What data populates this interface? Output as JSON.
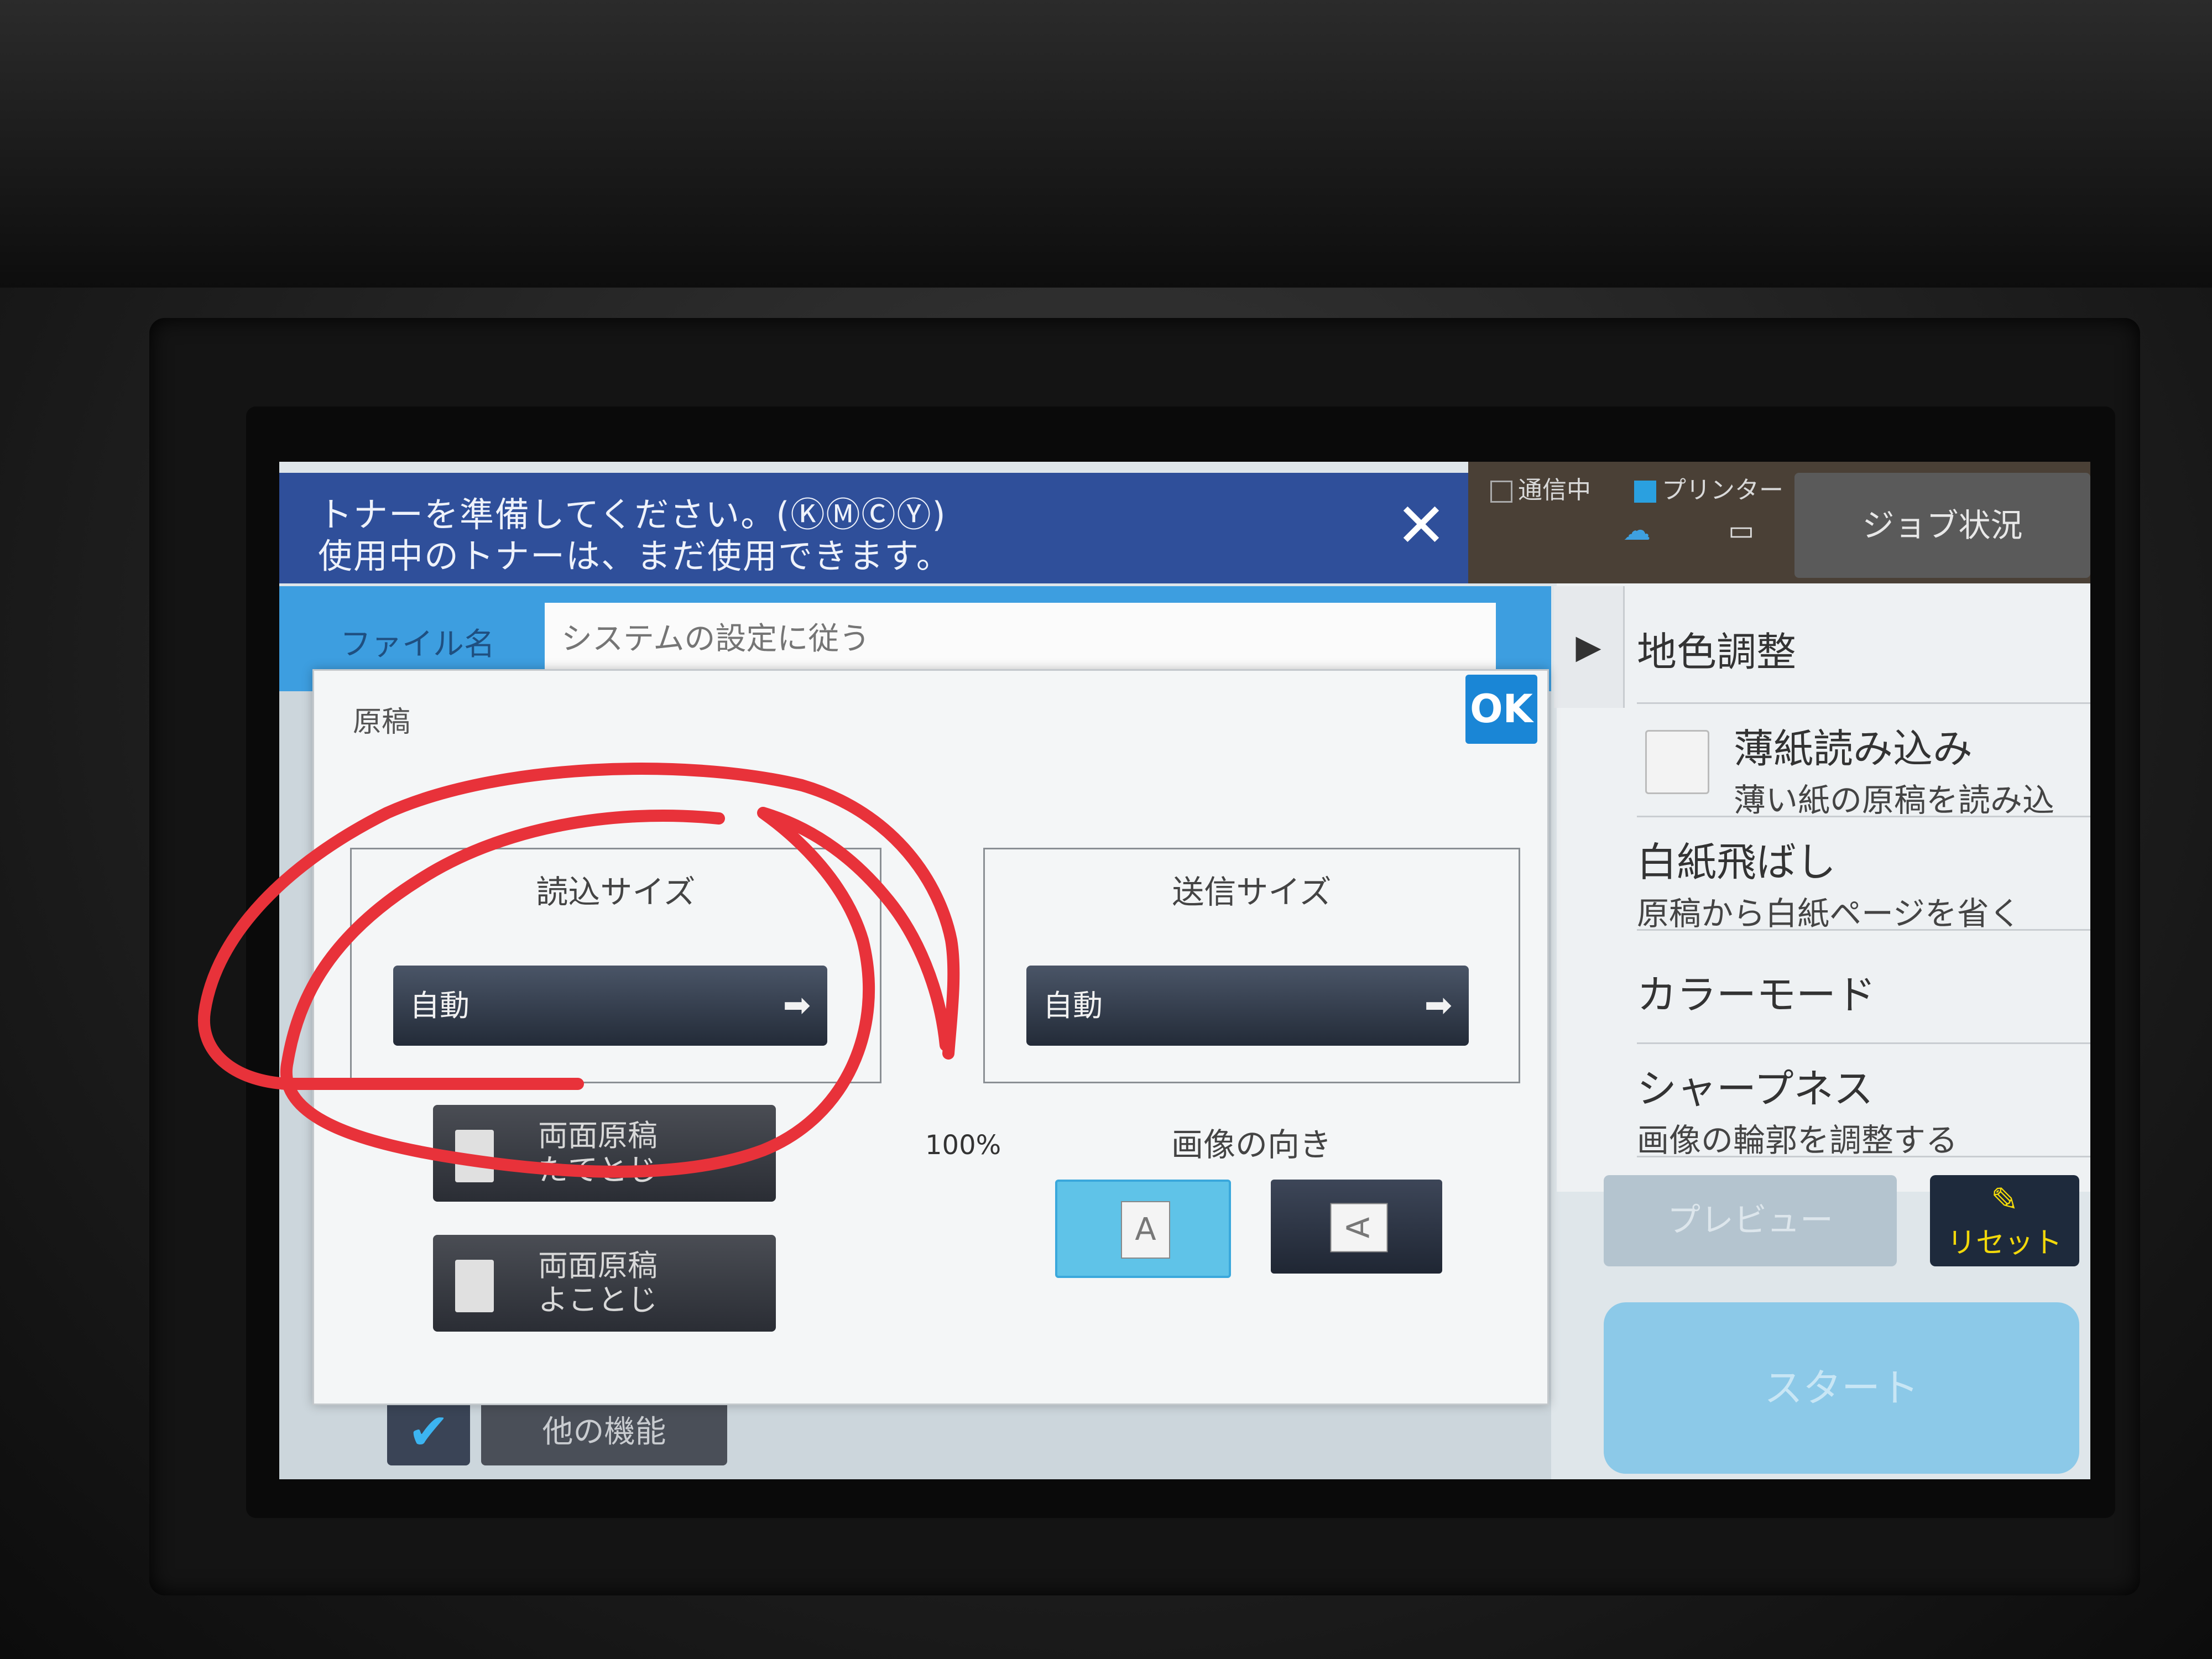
{
  "banner": {
    "line1": "トナーを準備してください。(ⓀⓂⒸⓎ)",
    "line2": "使用中のトナーは、まだ使用できます。",
    "close_symbol": "✕"
  },
  "status": {
    "communication": "通信中",
    "printer": "プリンター",
    "job_status_button": "ジョブ状況"
  },
  "file_row": {
    "label": "ファイル名",
    "placeholder": "システムの設定に従う"
  },
  "modal": {
    "title": "原稿",
    "ok_label": "OK",
    "scan_size": {
      "label": "読込サイズ",
      "value": "自動"
    },
    "send_size": {
      "label": "送信サイズ",
      "value": "自動"
    },
    "ratio": "100%",
    "duplex_tate": "両面原稿\nたてとじ",
    "duplex_yoko": "両面原稿\nよことじ",
    "orientation": {
      "label": "画像の向き",
      "portrait_glyph": "A",
      "landscape_glyph": "A",
      "selected": "portrait"
    }
  },
  "right_panel": {
    "expand_symbol": "▶",
    "items": [
      {
        "title": "地色調整",
        "sub": ""
      },
      {
        "title": "薄紙読み込み",
        "sub": "薄い紙の原稿を読み込"
      },
      {
        "title": "白紙飛ばし",
        "sub": "原稿から白紙ページを省く"
      },
      {
        "title": "カラーモード",
        "sub": ""
      },
      {
        "title": "シャープネス",
        "sub": "画像の輪郭を調整する"
      }
    ]
  },
  "actions": {
    "preview": "プレビュー",
    "reset": "リセット",
    "start": "スタート",
    "other_functions": "他の機能",
    "check_symbol": "✔"
  },
  "colors": {
    "banner": "#2f4f9a",
    "accent_blue": "#1a86d6",
    "annotation_red": "#e8323a",
    "reset_text": "#f2d80a"
  }
}
